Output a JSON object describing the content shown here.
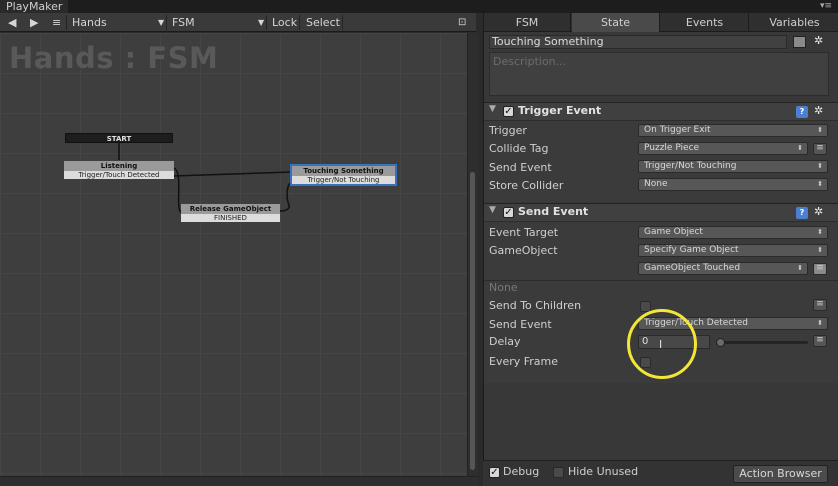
{
  "window": {
    "title": "PlayMaker"
  },
  "toolbar": {
    "back": "◀",
    "forward": "▶",
    "menu": "≡",
    "gameobject": "Hands",
    "fsm": "FSM",
    "lock": "Lock",
    "select": "Select"
  },
  "canvas": {
    "title": "Hands : FSM",
    "states": [
      {
        "name": "START",
        "event": ""
      },
      {
        "name": "Listening",
        "event": "Trigger/Touch Detected"
      },
      {
        "name": "Touching Something",
        "event": "Trigger/Not Touching"
      },
      {
        "name": "Release GameObject",
        "event": "FINISHED"
      }
    ]
  },
  "inspector": {
    "tabs": [
      "FSM",
      "State",
      "Events",
      "Variables"
    ],
    "active_tab": "State",
    "state_name": "Touching Something",
    "description_placeholder": "Description...",
    "actions": [
      {
        "title": "Trigger Event",
        "fields": [
          {
            "label": "Trigger",
            "value": "On Trigger Exit"
          },
          {
            "label": "Collide Tag",
            "value": "Puzzle Piece"
          },
          {
            "label": "Send Event",
            "value": "Trigger/Not Touching"
          },
          {
            "label": "Store Collider",
            "value": "None"
          }
        ]
      },
      {
        "title": "Send Event",
        "fields": [
          {
            "label": "Event Target",
            "value": "Game Object"
          },
          {
            "label": "GameObject",
            "value": "Specify Game Object"
          },
          {
            "label": "",
            "value": "GameObject Touched"
          },
          {
            "label": "",
            "value": "None"
          },
          {
            "label": "Send To Children",
            "value": ""
          },
          {
            "label": "Send Event",
            "value": "Trigger/Touch Detected"
          },
          {
            "label": "Delay",
            "value": "0"
          },
          {
            "label": "Every Frame",
            "value": ""
          }
        ]
      }
    ],
    "footer": {
      "debug": "Debug",
      "hide_unused": "Hide Unused",
      "action_browser": "Action Browser"
    }
  },
  "colors": {
    "highlight_ring": "#f2e636",
    "selected_state": "#3a70c0",
    "help_icon": "#4d7fd1"
  }
}
